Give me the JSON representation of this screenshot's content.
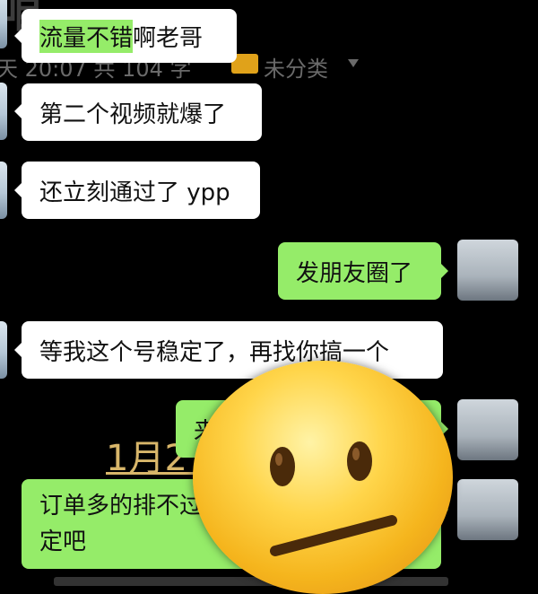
{
  "note_overlay": {
    "title": "咱",
    "meta": "天 20:07  共 104 字",
    "folder_label": "未分类",
    "date_fragment": "1月2"
  },
  "messages": [
    {
      "side": "left",
      "text_highlight": "流量不错",
      "text_rest": "啊老哥"
    },
    {
      "side": "left",
      "text": "第二个视频就爆了"
    },
    {
      "side": "left",
      "text": "还立刻通过了 ypp"
    },
    {
      "side": "right",
      "text": "发朋友圈了"
    },
    {
      "side": "left",
      "text": "等我这个号稳定了，再找你搞一个"
    },
    {
      "side": "right",
      "text": "来"
    },
    {
      "side": "right",
      "line1": "订单多的排不过",
      "line2": "定吧"
    }
  ],
  "emoji": "neutral-face",
  "colors": {
    "bubble_green": "#95ec69",
    "bubble_white": "#ffffff",
    "background": "#000000",
    "folder": "#e0a21a",
    "date": "#d8b66a"
  }
}
